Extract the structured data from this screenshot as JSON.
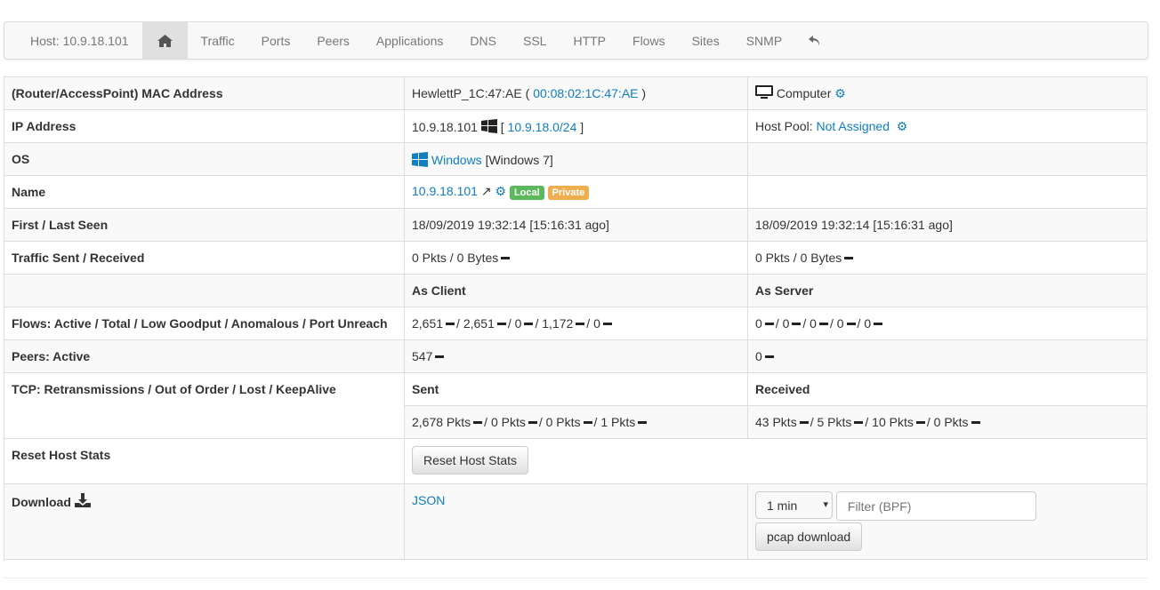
{
  "nav": {
    "host": "Host: 10.9.18.101",
    "items": [
      "Traffic",
      "Ports",
      "Peers",
      "Applications",
      "DNS",
      "SSL",
      "HTTP",
      "Flows",
      "Sites",
      "SNMP"
    ]
  },
  "rows": {
    "mac": {
      "label": "(Router/AccessPoint) MAC Address",
      "name": "HewlettP_1C:47:AE",
      "open": "(",
      "mac": "00:08:02:1C:47:AE",
      "close": ")",
      "type": "Computer"
    },
    "ip": {
      "label": "IP Address",
      "ip": "10.9.18.101",
      "open": "[",
      "net": "10.9.18.0/24",
      "close": "]",
      "pool_label": "Host Pool:",
      "pool": "Not Assigned"
    },
    "os": {
      "label": "OS",
      "os": "Windows",
      "ver": "[Windows 7]"
    },
    "name": {
      "label": "Name",
      "name": "10.9.18.101",
      "local": "Local",
      "private": "Private"
    },
    "seen": {
      "label": "First / Last Seen",
      "first": "18/09/2019 19:32:14 [15:16:31 ago]",
      "last": "18/09/2019 19:32:14 [15:16:31 ago]"
    },
    "traffic": {
      "label": "Traffic Sent / Received",
      "sent": "0 Pkts / 0 Bytes",
      "recv": "0 Pkts / 0 Bytes"
    },
    "roles": {
      "client": "As Client",
      "server": "As Server"
    },
    "flows": {
      "label": "Flows: Active / Total / Low Goodput / Anomalous / Port Unreach",
      "client": [
        "2,651",
        "2,651",
        "0",
        "1,172",
        "0"
      ],
      "server": [
        "0",
        "0",
        "0",
        "0",
        "0"
      ]
    },
    "peers": {
      "label": "Peers: Active",
      "client": "547",
      "server": "0"
    },
    "tcp": {
      "label": "TCP: Retransmissions / Out of Order / Lost / KeepAlive",
      "sent_h": "Sent",
      "recv_h": "Received",
      "sent": [
        "2,678 Pkts",
        "0 Pkts",
        "0 Pkts",
        "1 Pkts"
      ],
      "recv": [
        "43 Pkts",
        "5 Pkts",
        "10 Pkts",
        "0 Pkts"
      ]
    },
    "reset": {
      "label": "Reset Host Stats",
      "button": "Reset Host Stats"
    },
    "download": {
      "label": "Download",
      "json": "JSON",
      "interval": "1 min",
      "filter_placeholder": "Filter (BPF)",
      "pcap": "pcap download"
    }
  },
  "colors": {
    "link": "#0f7ec2",
    "local": "#5cb85c",
    "private": "#f0ad4e"
  }
}
